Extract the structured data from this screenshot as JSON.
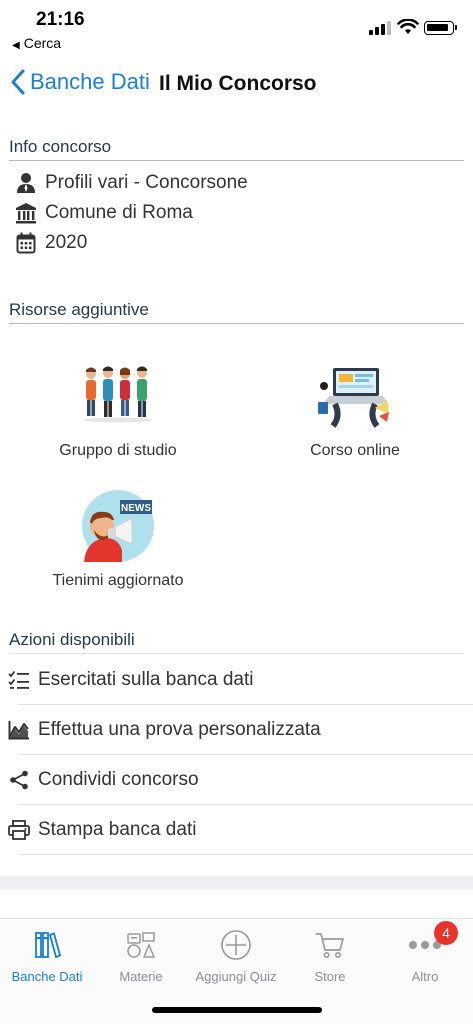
{
  "status_bar": {
    "time": "21:16",
    "back_app": "Cerca",
    "back_arrow": "◀"
  },
  "nav": {
    "back_label": "Banche Dati",
    "title": "Il Mio Concorso"
  },
  "info": {
    "header": "Info concorso",
    "rows": [
      {
        "icon": "person-icon",
        "text": "Profili vari - Concorsone"
      },
      {
        "icon": "institution-icon",
        "text": "Comune di Roma"
      },
      {
        "icon": "calendar-icon",
        "text": "2020"
      }
    ]
  },
  "resources": {
    "header": "Risorse aggiuntive",
    "items": [
      {
        "icon": "study-group-illustration",
        "label": "Gruppo di studio"
      },
      {
        "icon": "online-course-illustration",
        "label": "Corso online"
      },
      {
        "icon": "news-megaphone-illustration",
        "label": "Tienimi aggiornato",
        "news_text": "NEWS"
      }
    ]
  },
  "actions": {
    "header": "Azioni disponibili",
    "items": [
      {
        "icon": "checklist-icon",
        "label": "Esercitati sulla banca dati"
      },
      {
        "icon": "chart-icon",
        "label": "Effettua una prova personalizzata"
      },
      {
        "icon": "share-icon",
        "label": "Condividi concorso"
      },
      {
        "icon": "print-icon",
        "label": "Stampa banca dati"
      }
    ]
  },
  "tabbar": {
    "tabs": [
      {
        "icon": "books-icon",
        "label": "Banche Dati",
        "active": true
      },
      {
        "icon": "subjects-icon",
        "label": "Materie",
        "active": false
      },
      {
        "icon": "add-circle-icon",
        "label": "Aggiungi Quiz",
        "active": false
      },
      {
        "icon": "cart-icon",
        "label": "Store",
        "active": false
      },
      {
        "icon": "more-icon",
        "label": "Altro",
        "active": false
      }
    ],
    "badge": "4"
  },
  "colors": {
    "accent": "#1a7fd6",
    "badge": "#e8322c",
    "section_text": "#24394f"
  }
}
